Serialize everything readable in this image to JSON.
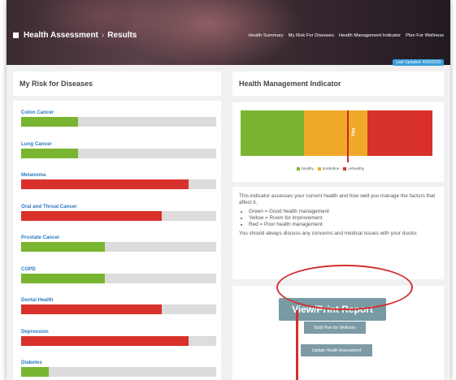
{
  "header": {
    "breadcrumb": {
      "section": "Health Assessment",
      "separator": "›",
      "current": "Results"
    },
    "nav": [
      "Health Summary",
      "My Risk For Diseases",
      "Health Management Indicator",
      "Plan For Wellness"
    ],
    "last_updated": "Last Updated: 4/25/2019"
  },
  "risk": {
    "title": "My Risk for Diseases",
    "diseases": [
      {
        "name": "Colon Cancer",
        "level": 0.29,
        "color": "#7ab532"
      },
      {
        "name": "Lung Cancer",
        "level": 0.29,
        "color": "#7ab532"
      },
      {
        "name": "Melanoma",
        "level": 0.86,
        "color": "#d8312b"
      },
      {
        "name": "Oral and Throat Cancer",
        "level": 0.72,
        "color": "#d8312b"
      },
      {
        "name": "Prostate Cancer",
        "level": 0.43,
        "color": "#7ab532"
      },
      {
        "name": "COPD",
        "level": 0.43,
        "color": "#7ab532"
      },
      {
        "name": "Dental Health",
        "level": 0.72,
        "color": "#d8312b"
      },
      {
        "name": "Depression",
        "level": 0.86,
        "color": "#d8312b"
      },
      {
        "name": "Diabetes",
        "level": 0.14,
        "color": "#7ab532"
      }
    ]
  },
  "hmi": {
    "title": "Health Management Indicator",
    "marker_label": "You",
    "marker_position": 0.56,
    "segments": [
      {
        "name": "healthy",
        "color": "#7ab532"
      },
      {
        "name": "borderline",
        "color": "#efa928"
      },
      {
        "name": "unhealthy",
        "color": "#d8312b"
      }
    ],
    "legend": [
      "healthy",
      "borderline",
      "unhealthy"
    ],
    "description": "This indicator assesses your current health and how well you manage the factors that affect it.",
    "bullets": [
      "Green = Good health management",
      "Yellow = Room for improvement",
      "Red = Poor health management"
    ],
    "note": "You should always discuss any concerns and medical issues with your doctor."
  },
  "actions": {
    "print": "View/Print Report",
    "plan": "Build Plan for Wellness",
    "update": "Update Health Assessment"
  },
  "colors": {
    "accent": "#3a9ed8",
    "button": "#779aa4",
    "highlight": "#d32f2f"
  }
}
